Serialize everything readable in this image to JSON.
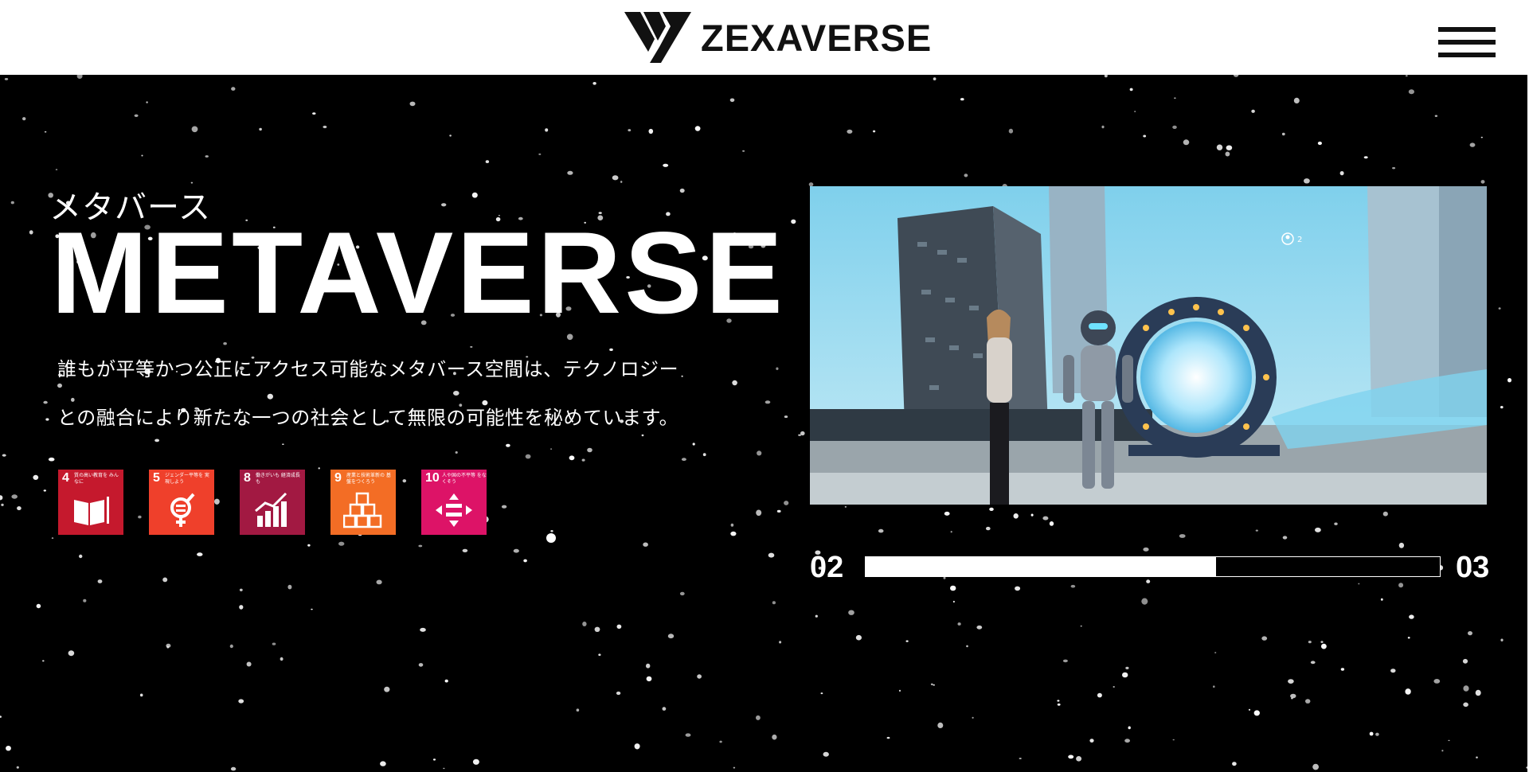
{
  "header": {
    "logo_icon": "zexaverse-logo-mark",
    "logo_text": "ZEXAVERSE",
    "menu_icon": "hamburger-menu-icon"
  },
  "hero": {
    "subtitle": "メタバース",
    "title": "METAVERSE",
    "description": "誰もが平等かつ公正にアクセス可能なメタバース空間は、テクノロジーとの融合により新たな一つの社会として無限の可能性を秘めています。",
    "sdgs": [
      {
        "number": "4",
        "label": "質の高い教育を みんなに",
        "color": "#C5192D",
        "icon": "book-pencil-icon"
      },
      {
        "number": "5",
        "label": "ジェンダー平等を 実現しよう",
        "color": "#EF402B",
        "icon": "gender-equality-icon"
      },
      {
        "number": "8",
        "label": "働きがいも 経済成長も",
        "color": "#A21942",
        "icon": "growth-chart-icon"
      },
      {
        "number": "9",
        "label": "産業と技術革新の 基盤をつくろう",
        "color": "#F36D25",
        "icon": "cubes-icon"
      },
      {
        "number": "10",
        "label": "人や国の不平等 をなくそう",
        "color": "#DD1367",
        "icon": "arrows-equal-icon"
      }
    ],
    "media": {
      "description_icon": "metaverse-scene-image",
      "user_count": "2"
    },
    "slider": {
      "current": "02",
      "total": "03",
      "progress": 0.61
    }
  }
}
